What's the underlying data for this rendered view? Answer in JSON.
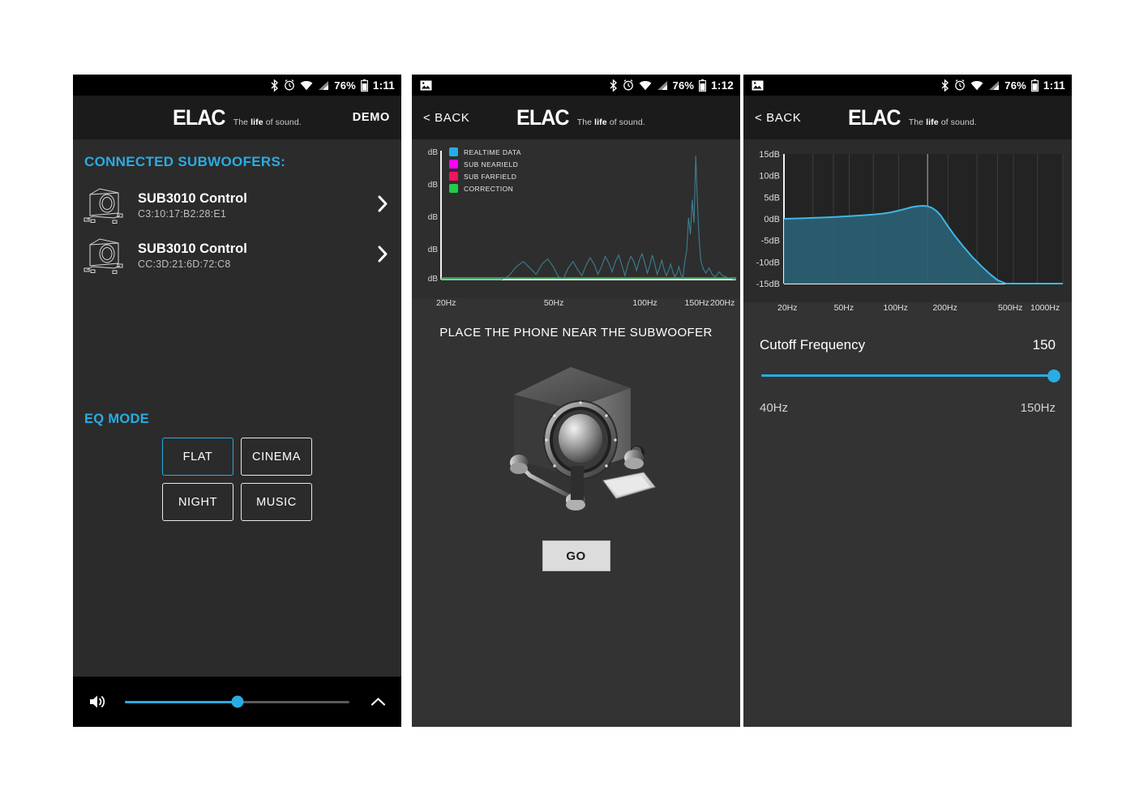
{
  "status_bar": {
    "bluetooth_icon": "bluetooth-icon",
    "alarm_icon": "alarm-clock-icon",
    "wifi_icon": "wifi-icon",
    "signal_icon": "cell-signal-icon",
    "battery_pct": "76%",
    "battery_icon": "battery-icon",
    "time_p1": "1:11",
    "time_p2": "1:12",
    "time_p3": "1:11",
    "photo_icon": "photo-notification-icon"
  },
  "brand": {
    "logo_text": "ELAC",
    "tagline_pre": "The ",
    "tagline_bold": "life",
    "tagline_post": " of sound."
  },
  "nav_bar": {
    "back_icon": "triangle-back-icon",
    "home_icon": "circle-home-icon",
    "recents_icon": "square-recents-icon"
  },
  "colors": {
    "accent": "#29ace3",
    "panel_bg": "#2b2b2b",
    "header_bg": "#1b1b1b",
    "status_bg": "#000000"
  },
  "phone1": {
    "demo_label": "DEMO",
    "section_title": "CONNECTED SUBWOOFERS:",
    "subwoofers": [
      {
        "name": "SUB3010 Control",
        "mac": "C3:10:17:B2:28:E1",
        "thumb_icon": "subwoofer-icon",
        "chevron_icon": "chevron-right-icon"
      },
      {
        "name": "SUB3010 Control",
        "mac": "CC:3D:21:6D:72:C8",
        "thumb_icon": "subwoofer-icon",
        "chevron_icon": "chevron-right-icon"
      }
    ],
    "eq_label": "EQ MODE",
    "eq_modes": [
      {
        "label": "FLAT",
        "selected": true
      },
      {
        "label": "CINEMA",
        "selected": false
      },
      {
        "label": "NIGHT",
        "selected": false
      },
      {
        "label": "MUSIC",
        "selected": false
      }
    ],
    "volume": {
      "icon": "speaker-volume-icon",
      "value_pct": 50,
      "caret_icon": "chevron-up-icon"
    }
  },
  "phone2": {
    "back_label": "< BACK",
    "hint_text": "PLACE THE PHONE NEAR THE SUBWOOFER",
    "subwoofer_image": "subwoofer-photo",
    "go_label": "GO",
    "chart_data": {
      "type": "line",
      "title": "",
      "xlabel": "",
      "ylabel": "dB",
      "legend_position": "top-left",
      "grid": false,
      "xticks": [
        "20Hz",
        "50Hz",
        "100Hz",
        "150Hz",
        "200Hz"
      ],
      "yticks": [
        "dB",
        "dB",
        "dB",
        "dB",
        "dB"
      ],
      "xscale": "log",
      "xlim": [
        20,
        200
      ],
      "series": [
        {
          "name": "REALTIME DATA",
          "color": "#29ace3",
          "x": [
            20,
            25,
            30,
            32,
            34,
            36,
            38,
            40,
            42,
            44,
            46,
            48,
            50,
            52,
            54,
            56,
            58,
            60,
            62,
            64,
            66,
            68,
            70,
            72,
            74,
            76,
            78,
            80,
            82,
            84,
            86,
            88,
            90,
            92,
            94,
            96,
            98,
            100,
            102,
            104,
            106,
            108,
            110,
            112,
            114,
            116,
            118,
            120,
            122,
            124,
            126,
            128,
            130,
            132,
            134,
            136,
            138,
            140,
            142,
            144,
            146,
            148,
            150,
            152,
            155,
            158,
            162,
            166,
            170,
            175,
            180,
            190,
            200
          ],
          "y": [
            0,
            0,
            0,
            0,
            3,
            10,
            14,
            9,
            4,
            12,
            16,
            10,
            2,
            1,
            9,
            14,
            8,
            3,
            11,
            17,
            12,
            4,
            10,
            18,
            13,
            6,
            14,
            19,
            11,
            3,
            12,
            18,
            14,
            7,
            15,
            20,
            13,
            5,
            11,
            19,
            12,
            4,
            9,
            15,
            8,
            3,
            7,
            12,
            6,
            2,
            5,
            10,
            4,
            1,
            14,
            22,
            48,
            35,
            62,
            44,
            96,
            58,
            30,
            14,
            8,
            5,
            9,
            4,
            2,
            6,
            3,
            1,
            0
          ]
        },
        {
          "name": "SUB NEARIELD",
          "color": "#ff00ff",
          "x": [],
          "y": []
        },
        {
          "name": "SUB FARFIELD",
          "color": "#f1145c",
          "x": [],
          "y": []
        },
        {
          "name": "CORRECTION",
          "color": "#22cc4a",
          "x": [
            20,
            200
          ],
          "y": [
            0,
            0
          ]
        }
      ]
    }
  },
  "phone3": {
    "back_label": "< BACK",
    "cutoff_label": "Cutoff Frequency",
    "cutoff_value": "150",
    "range_min_label": "40Hz",
    "range_max_label": "150Hz",
    "slider_pct": 100,
    "chart_data": {
      "type": "area",
      "title": "",
      "xlabel": "",
      "ylabel": "dB",
      "grid": true,
      "legend_position": "none",
      "xscale": "log",
      "xlim": [
        20,
        1000
      ],
      "ylim": [
        -15,
        15
      ],
      "xticks": [
        "20Hz",
        "50Hz",
        "100Hz",
        "200Hz",
        "500Hz",
        "1000Hz"
      ],
      "yticks": [
        "15dB",
        "10dB",
        "5dB",
        "0dB",
        "-5dB",
        "-10dB",
        "-15dB"
      ],
      "cursor_x": 150,
      "series": [
        {
          "name": "Response",
          "color": "#3fb6e6",
          "fill": "#2b5f72",
          "x": [
            20,
            25,
            30,
            35,
            40,
            50,
            60,
            70,
            80,
            90,
            100,
            110,
            120,
            130,
            140,
            150,
            160,
            170,
            180,
            200,
            220,
            250,
            280,
            320,
            360,
            400,
            450,
            500,
            600,
            800,
            1000
          ],
          "y": [
            0.0,
            0.1,
            0.2,
            0.3,
            0.4,
            0.6,
            0.8,
            1.0,
            1.2,
            1.5,
            1.9,
            2.3,
            2.7,
            2.9,
            3.0,
            2.9,
            2.5,
            1.8,
            0.8,
            -1.8,
            -4.0,
            -6.6,
            -8.8,
            -11.0,
            -12.8,
            -14.2,
            -15.0,
            -15.0,
            -15.0,
            -15.0,
            -15.0
          ]
        }
      ]
    }
  }
}
